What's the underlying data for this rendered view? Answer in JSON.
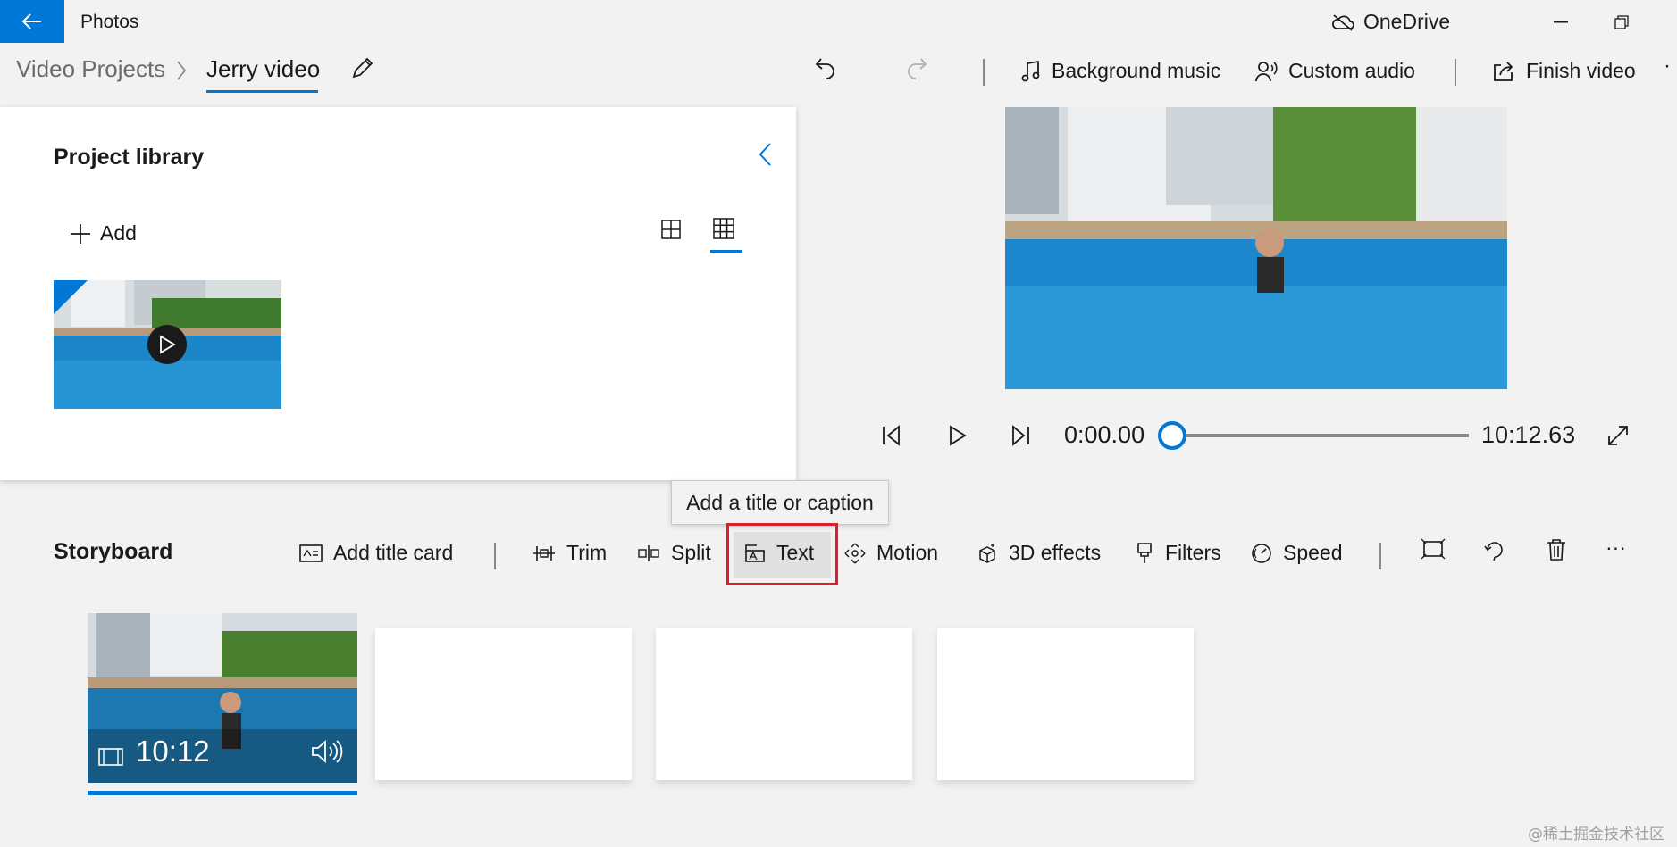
{
  "titlebar": {
    "app_title": "Photos",
    "onedrive_label": "OneDrive"
  },
  "breadcrumb": {
    "root": "Video Projects",
    "current": "Jerry video"
  },
  "toolbar": {
    "background_music": "Background music",
    "custom_audio": "Custom audio",
    "finish_video": "Finish video",
    "more": "·"
  },
  "library": {
    "title": "Project library",
    "add_label": "Add"
  },
  "player": {
    "current_time": "0:00.00",
    "total_time": "10:12.63",
    "progress": 0
  },
  "tooltip": {
    "text": "Add a title or caption"
  },
  "storyboard": {
    "title": "Storyboard",
    "add_title_card": "Add title card",
    "trim": "Trim",
    "split": "Split",
    "text": "Text",
    "motion": "Motion",
    "effects_3d": "3D effects",
    "filters": "Filters",
    "speed": "Speed",
    "more": "···",
    "clip_duration": "10:12"
  },
  "watermark": "@稀土掘金技术社区",
  "colors": {
    "accent": "#0078d7",
    "highlight": "#d9202b"
  }
}
